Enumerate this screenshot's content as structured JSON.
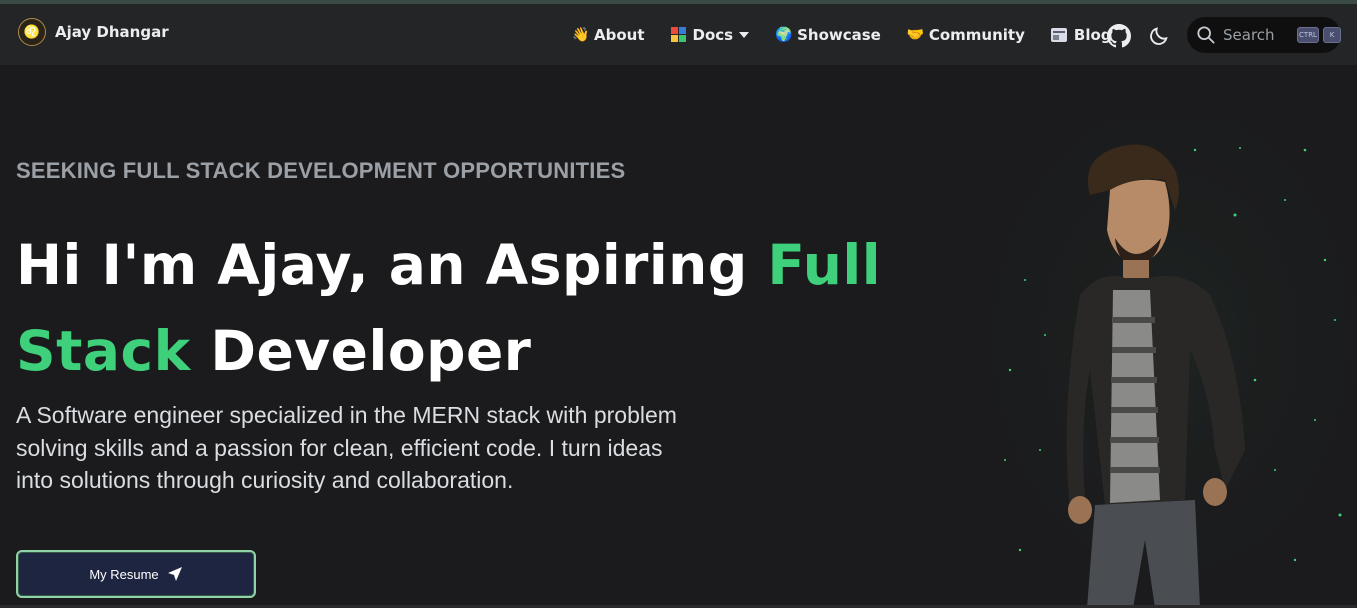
{
  "brand": {
    "title": "Ajay Dhangar",
    "logo_icon": "lion-crest-icon"
  },
  "nav": {
    "items": [
      {
        "label": "About",
        "icon": "waving-hand-icon"
      },
      {
        "label": "Docs",
        "icon": "books-icon",
        "dropdown": true
      },
      {
        "label": "Showcase",
        "icon": "globe-icon"
      },
      {
        "label": "Community",
        "icon": "handshake-icon"
      },
      {
        "label": "Blog",
        "icon": "newspaper-icon"
      }
    ],
    "github_icon": "github-icon",
    "theme_icon": "moon-icon"
  },
  "search": {
    "placeholder": "Search",
    "key1": "CTRL",
    "key2": "K"
  },
  "hero": {
    "subtitle": "SEEKING FULL STACK DEVELOPMENT OPPORTUNITIES",
    "headline_pre": "Hi I'm Ajay, an Aspiring ",
    "headline_accent": "Full Stack",
    "headline_post": " Developer",
    "description": "A Software engineer specialized in the MERN stack with problem solving skills and a passion for clean, efficient code. I turn ideas into solutions through curiosity and collaboration.",
    "resume_label": "My Resume",
    "resume_icon": "paper-plane-icon"
  },
  "colors": {
    "accent": "#3ed07a",
    "background": "#1b1b1d",
    "navbar": "#242526",
    "button_bg": "#1d2540",
    "button_border": "#8fd4a8"
  }
}
